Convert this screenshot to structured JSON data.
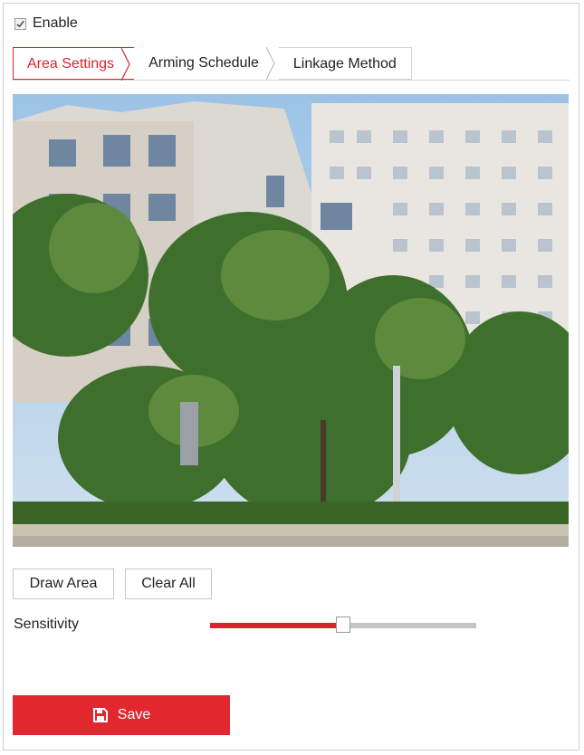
{
  "enable": {
    "label": "Enable",
    "checked": true
  },
  "tabs": [
    {
      "label": "Area Settings",
      "active": true
    },
    {
      "label": "Arming Schedule",
      "active": false
    },
    {
      "label": "Linkage Method",
      "active": false
    }
  ],
  "buttons": {
    "draw_area": "Draw Area",
    "clear_all": "Clear All"
  },
  "sensitivity": {
    "label": "Sensitivity",
    "value_percent": 50
  },
  "save": {
    "label": "Save",
    "icon": "floppy-disk-icon"
  },
  "colors": {
    "accent": "#d7262b",
    "track": "#c4c4c4"
  }
}
